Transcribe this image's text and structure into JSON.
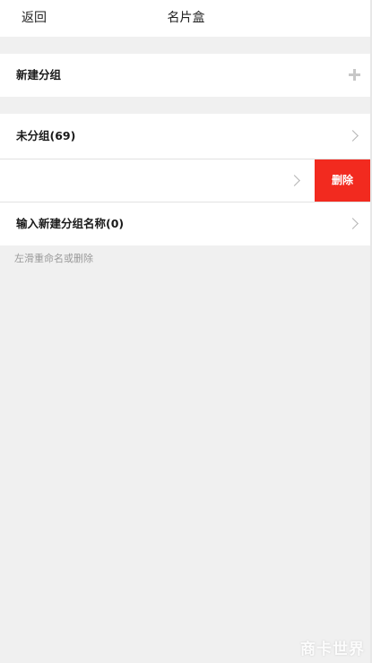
{
  "nav": {
    "back_label": "返回",
    "title": "名片盒"
  },
  "groups": {
    "new_group_label": "新建分组",
    "new_group_icon": "plus-icon",
    "ungrouped_label": "未分组(69)",
    "swiped_row_label": "",
    "delete_label": "删除",
    "input_new_group_label": "输入新建分组名称(0)"
  },
  "hint": "左滑重命名或删除",
  "colors": {
    "delete": "#f22a1f",
    "background": "#f0f0f0"
  },
  "watermark": "商卡世界"
}
